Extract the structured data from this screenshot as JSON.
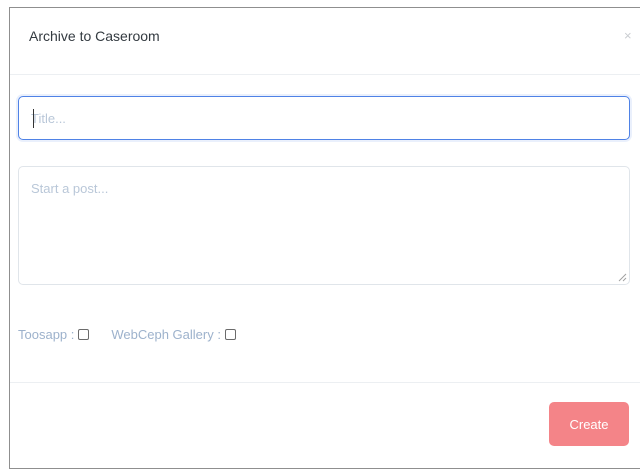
{
  "modal": {
    "title": "Archive to Caseroom",
    "close_symbol": "×"
  },
  "form": {
    "title_placeholder": "Title...",
    "title_value": "",
    "post_placeholder": "Start a post...",
    "post_value": ""
  },
  "options": [
    {
      "label": "Toosapp :",
      "checked": false
    },
    {
      "label": "WebCeph Gallery :",
      "checked": false
    }
  ],
  "footer": {
    "create_label": "Create"
  },
  "colors": {
    "accent_focus": "#4f82e6",
    "create_button": "#f48488",
    "label_text": "#9db2cc"
  },
  "icons": [
    "close-icon",
    "resize-grip-icon"
  ]
}
